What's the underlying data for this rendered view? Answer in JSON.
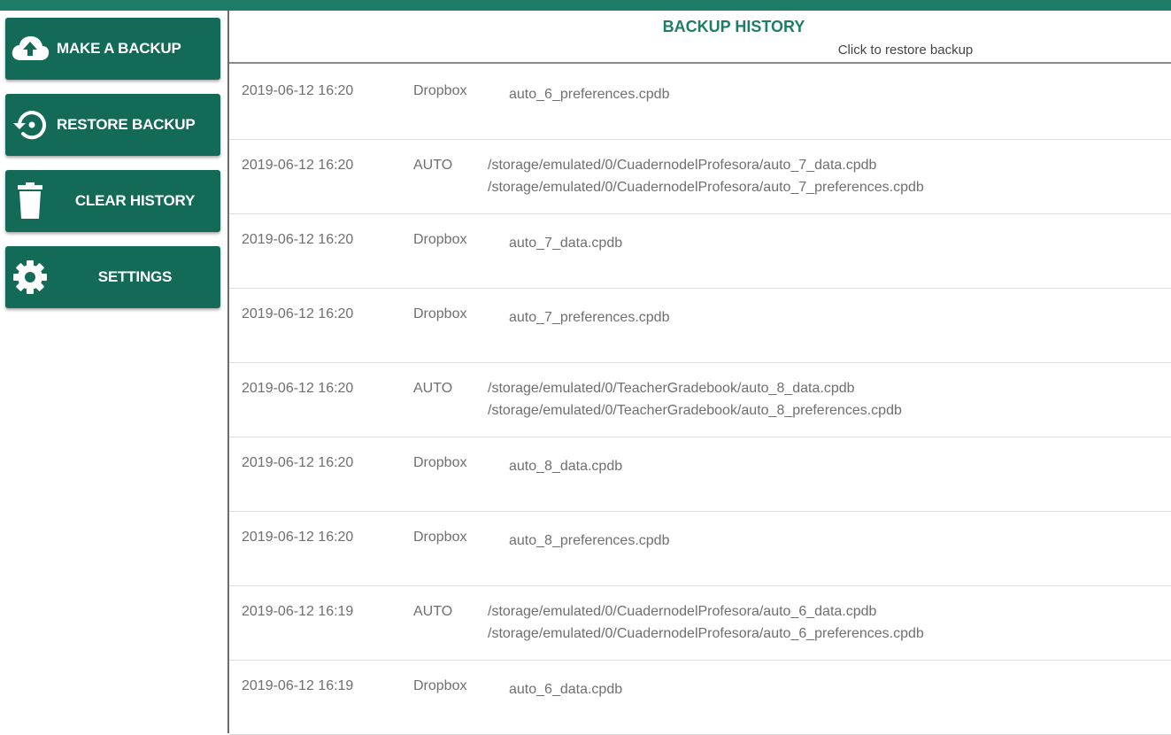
{
  "colors": {
    "accent": "#1e7d66",
    "button_bg": "#136a57"
  },
  "sidebar": {
    "buttons": [
      {
        "label": "MAKE A BACKUP",
        "icon": "cloud-upload-icon"
      },
      {
        "label": "RESTORE BACKUP",
        "icon": "restore-icon"
      },
      {
        "label": "CLEAR HISTORY",
        "icon": "trash-icon"
      },
      {
        "label": "SETTINGS",
        "icon": "gear-icon"
      }
    ]
  },
  "header": {
    "title": "BACKUP HISTORY",
    "subtitle": "Click to restore backup"
  },
  "rows": [
    {
      "date": "2019-06-12 16:20",
      "source": "Dropbox",
      "file1": "auto_6_preferences.cpdb",
      "file2": ""
    },
    {
      "date": "2019-06-12 16:20",
      "source": "AUTO",
      "file1": "/storage/emulated/0/CuadernodelProfesora/auto_7_data.cpdb",
      "file2": "/storage/emulated/0/CuadernodelProfesora/auto_7_preferences.cpdb"
    },
    {
      "date": "2019-06-12 16:20",
      "source": "Dropbox",
      "file1": "auto_7_data.cpdb",
      "file2": ""
    },
    {
      "date": "2019-06-12 16:20",
      "source": "Dropbox",
      "file1": "auto_7_preferences.cpdb",
      "file2": ""
    },
    {
      "date": "2019-06-12 16:20",
      "source": "AUTO",
      "file1": "/storage/emulated/0/TeacherGradebook/auto_8_data.cpdb",
      "file2": "/storage/emulated/0/TeacherGradebook/auto_8_preferences.cpdb"
    },
    {
      "date": "2019-06-12 16:20",
      "source": "Dropbox",
      "file1": "auto_8_data.cpdb",
      "file2": ""
    },
    {
      "date": "2019-06-12 16:20",
      "source": "Dropbox",
      "file1": "auto_8_preferences.cpdb",
      "file2": ""
    },
    {
      "date": "2019-06-12 16:19",
      "source": "AUTO",
      "file1": "/storage/emulated/0/CuadernodelProfesora/auto_6_data.cpdb",
      "file2": "/storage/emulated/0/CuadernodelProfesora/auto_6_preferences.cpdb"
    },
    {
      "date": "2019-06-12 16:19",
      "source": "Dropbox",
      "file1": "auto_6_data.cpdb",
      "file2": ""
    }
  ]
}
